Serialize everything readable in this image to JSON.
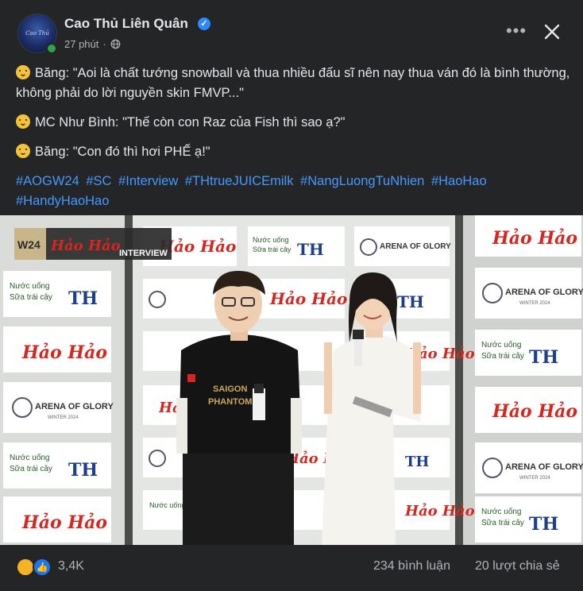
{
  "post": {
    "page_name": "Cao Thủ Liên Quân",
    "time": "27 phút",
    "separator": "·",
    "avatar_text": "Cao Thủ"
  },
  "content": {
    "line1": "Băng: \"Aoi là chất tướng snowball và thua nhiều đấu sĩ nên nay thua ván đó là bình thường, không phải do lời nguyền skin FMVP...\"",
    "line2": "MC Như Bình: \"Thế còn con Raz của Fish thì sao ạ?\"",
    "line3": "Băng: \"Con đó thì hơi PHẾ ạ!\"",
    "hashtags": [
      "#AOGW24",
      "#SC",
      "#Interview",
      "#THtrueJUICEmilk",
      "#NangLuongTuNhien",
      "#HaoHao",
      "#HandyHaoHao"
    ]
  },
  "photo": {
    "corner_badge": "W24",
    "corner_brand": "Hảo Hảo",
    "corner_label": "INTERVIEW",
    "brand_haohao": "Hảo Hảo",
    "brand_th_line1": "Nước uống",
    "brand_th_line2": "Sữa trái cây",
    "brand_th_logo": "TH",
    "brand_aog": "ARENA OF GLORY",
    "brand_aog_sub": "WINTER 2024",
    "shirt_text_1": "SAIGON",
    "shirt_text_2": "PHANTOM"
  },
  "stats": {
    "reactions": "3,4K",
    "comments": "234 bình luận",
    "shares": "20 lượt chia sẻ"
  },
  "colors": {
    "background": "#242526",
    "text": "#e4e6eb",
    "secondary": "#b0b3b8",
    "hashtag": "#4599ff",
    "verified": "#2d88ff",
    "haohao_red": "#d7261e"
  }
}
